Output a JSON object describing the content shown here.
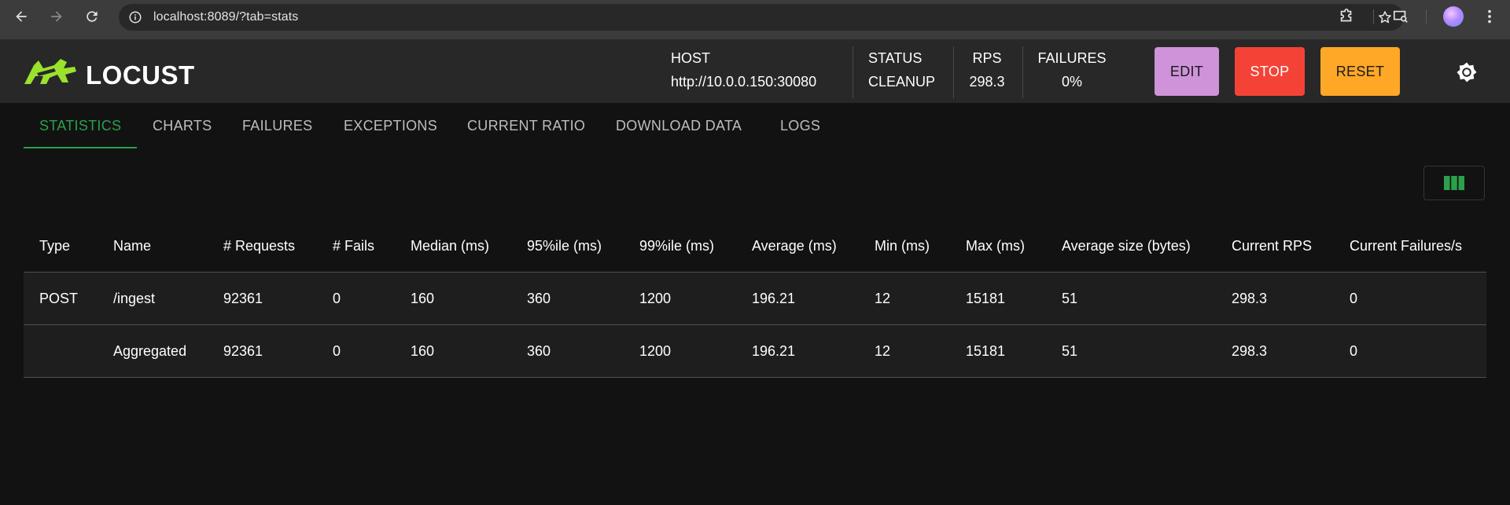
{
  "browser": {
    "url": "localhost:8089/?tab=stats"
  },
  "app": {
    "brand": "LOCUST",
    "host_label": "HOST",
    "host_value": "http://10.0.0.150:30080",
    "status_label": "STATUS",
    "status_value": "CLEANUP",
    "rps_label": "RPS",
    "rps_value": "298.3",
    "failures_label": "FAILURES",
    "failures_value": "0%",
    "buttons": {
      "edit": "EDIT",
      "stop": "STOP",
      "reset": "RESET"
    },
    "colors": {
      "edit": "#ce93d8",
      "stop": "#f44336",
      "reset": "#ffa726",
      "accent": "#2aa14a",
      "logo": "#9be22d"
    }
  },
  "tabs": [
    {
      "label": "STATISTICS",
      "active": true
    },
    {
      "label": "CHARTS"
    },
    {
      "label": "FAILURES"
    },
    {
      "label": "EXCEPTIONS"
    },
    {
      "label": "CURRENT RATIO"
    },
    {
      "label": "DOWNLOAD DATA"
    },
    {
      "label": "LOGS"
    }
  ],
  "table": {
    "headers": [
      "Type",
      "Name",
      "# Requests",
      "# Fails",
      "Median (ms)",
      "95%ile (ms)",
      "99%ile (ms)",
      "Average (ms)",
      "Min (ms)",
      "Max (ms)",
      "Average size (bytes)",
      "Current RPS",
      "Current Failures/s"
    ],
    "rows": [
      [
        "POST",
        "/ingest",
        "92361",
        "0",
        "160",
        "360",
        "1200",
        "196.21",
        "12",
        "15181",
        "51",
        "298.3",
        "0"
      ],
      [
        "",
        "Aggregated",
        "92361",
        "0",
        "160",
        "360",
        "1200",
        "196.21",
        "12",
        "15181",
        "51",
        "298.3",
        "0"
      ]
    ]
  },
  "icons": {
    "back": "arrow-left-icon",
    "forward": "arrow-right-icon",
    "reload": "reload-icon",
    "info": "info-icon",
    "bookmark": "star-icon",
    "extensions": "puzzle-icon",
    "media": "media-search-icon",
    "menu": "kebab-menu-icon",
    "theme": "brightness-icon",
    "columns": "view-column-icon"
  }
}
